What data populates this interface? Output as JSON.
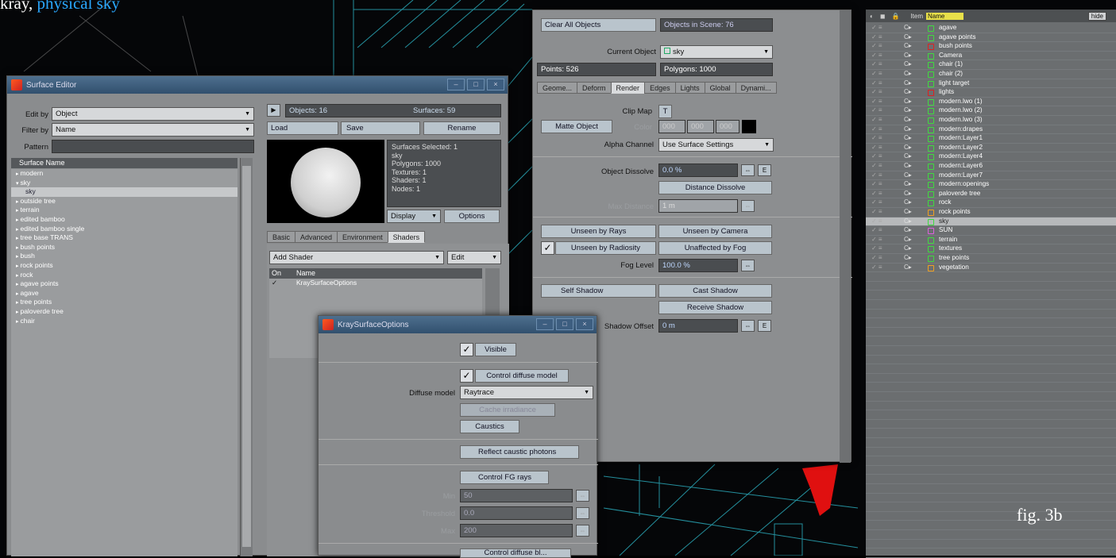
{
  "heading": {
    "prefix": "kray,",
    "highlight": "physical sky"
  },
  "figure_label": "fig. 3b",
  "surface_editor": {
    "title": "Surface Editor",
    "edit_by_label": "Edit by",
    "edit_by_value": "Object",
    "filter_by_label": "Filter by",
    "filter_by_value": "Name",
    "pattern_label": "Pattern",
    "list_header": "Surface Name",
    "surfaces": [
      "modern",
      "sky",
      "sky",
      "outside tree",
      "terrain",
      "edited bamboo",
      "edited bamboo single",
      "tree base TRANS",
      "bush points",
      "bush",
      "rock points",
      "rock",
      "agave points",
      "agave",
      "tree points",
      "paloverde tree",
      "chair"
    ],
    "objects_count": "Objects: 16",
    "surfaces_count": "Surfaces: 59",
    "load": "Load",
    "save": "Save",
    "rename": "Rename",
    "info_lines": [
      "Surfaces Selected: 1",
      "sky",
      "Polygons: 1000",
      "Textures: 1",
      "Shaders: 1",
      "Nodes: 1"
    ],
    "display": "Display",
    "options": "Options",
    "tabs": [
      "Basic",
      "Advanced",
      "Environment",
      "Shaders"
    ],
    "add_shader": "Add Shader",
    "edit": "Edit",
    "shader_col_on": "On",
    "shader_col_name": "Name",
    "shader_item": "KraySurfaceOptions"
  },
  "object_props": {
    "clear_all": "Clear All Objects",
    "objects_in_scene": "Objects in Scene: 76",
    "current_object_label": "Current Object",
    "current_object_value": "sky",
    "points": "Points: 526",
    "polygons": "Polygons: 1000",
    "tabs": [
      "Geome...",
      "Deform",
      "Render",
      "Edges",
      "Lights",
      "Global",
      "Dynami..."
    ],
    "clip_map_label": "Clip Map",
    "clip_map_btn": "T",
    "matte_object": "Matte Object",
    "color_label": "Color",
    "color_values": [
      "000",
      "000",
      "000"
    ],
    "alpha_channel_label": "Alpha Channel",
    "alpha_channel_value": "Use Surface Settings",
    "object_dissolve_label": "Object Dissolve",
    "object_dissolve_value": "0.0 %",
    "env_btn": "E",
    "distance_dissolve": "Distance Dissolve",
    "max_distance_label": "Max Distance",
    "max_distance_value": "1 m",
    "unseen_by_rays": "Unseen by Rays",
    "unseen_by_camera": "Unseen by Camera",
    "unseen_by_radiosity": "Unseen by Radiosity",
    "unaffected_by_fog": "Unaffected by Fog",
    "fog_level_label": "Fog Level",
    "fog_level_value": "100.0 %",
    "self_shadow": "Self Shadow",
    "cast_shadow": "Cast Shadow",
    "receive_shadow": "Receive Shadow",
    "shadow_offset_label": "Shadow Offset",
    "shadow_offset_value": "0 m"
  },
  "kray_options": {
    "title": "KraySurfaceOptions",
    "visible": "Visible",
    "control_diffuse": "Control diffuse model",
    "diffuse_model_label": "Diffuse model",
    "diffuse_model_value": "Raytrace",
    "cache_irradiance": "Cache irradiance",
    "caustics": "Caustics",
    "reflect_caustic": "Reflect caustic photons",
    "control_fg": "Control FG rays",
    "min_label": "Min",
    "min_value": "50",
    "threshold_label": "Threshold",
    "threshold_value": "0.0",
    "max_label": "Max",
    "max_value": "200",
    "next_btn": "Control diffuse bl..."
  },
  "scene_editor": {
    "header_item": "Item",
    "header_name": "Name",
    "hide": "hide",
    "items": [
      {
        "name": "agave",
        "color": "#3fdc3f"
      },
      {
        "name": "agave points",
        "color": "#3fdc3f"
      },
      {
        "name": "bush points",
        "color": "#e02020"
      },
      {
        "name": "Camera",
        "color": "#3fdc3f"
      },
      {
        "name": "chair (1)",
        "color": "#3fdc3f"
      },
      {
        "name": "chair (2)",
        "color": "#3fdc3f"
      },
      {
        "name": "light target",
        "color": "#3fdc3f"
      },
      {
        "name": "lights",
        "color": "#e02020"
      },
      {
        "name": "modern.lwo (1)",
        "color": "#3fdc3f"
      },
      {
        "name": "modern.lwo (2)",
        "color": "#3fdc3f"
      },
      {
        "name": "modern.lwo (3)",
        "color": "#3fdc3f"
      },
      {
        "name": "modern:drapes",
        "color": "#3fdc3f"
      },
      {
        "name": "modern:Layer1",
        "color": "#3fdc3f"
      },
      {
        "name": "modern:Layer2",
        "color": "#3fdc3f"
      },
      {
        "name": "modern:Layer4",
        "color": "#3fdc3f"
      },
      {
        "name": "modern:Layer6",
        "color": "#3fdc3f"
      },
      {
        "name": "modern:Layer7",
        "color": "#3fdc3f"
      },
      {
        "name": "modern:openings",
        "color": "#3fdc3f"
      },
      {
        "name": "paloverde tree",
        "color": "#3fdc3f"
      },
      {
        "name": "rock",
        "color": "#3fdc3f"
      },
      {
        "name": "rock points",
        "color": "#f0a020"
      },
      {
        "name": "sky",
        "color": "#3fdc3f"
      },
      {
        "name": "SUN",
        "color": "#e060e0"
      },
      {
        "name": "terrain",
        "color": "#3fdc3f"
      },
      {
        "name": "textures",
        "color": "#3fdc3f"
      },
      {
        "name": "tree points",
        "color": "#3fdc3f"
      },
      {
        "name": "vegetation",
        "color": "#f0a020"
      }
    ],
    "selected_item": "sky"
  }
}
